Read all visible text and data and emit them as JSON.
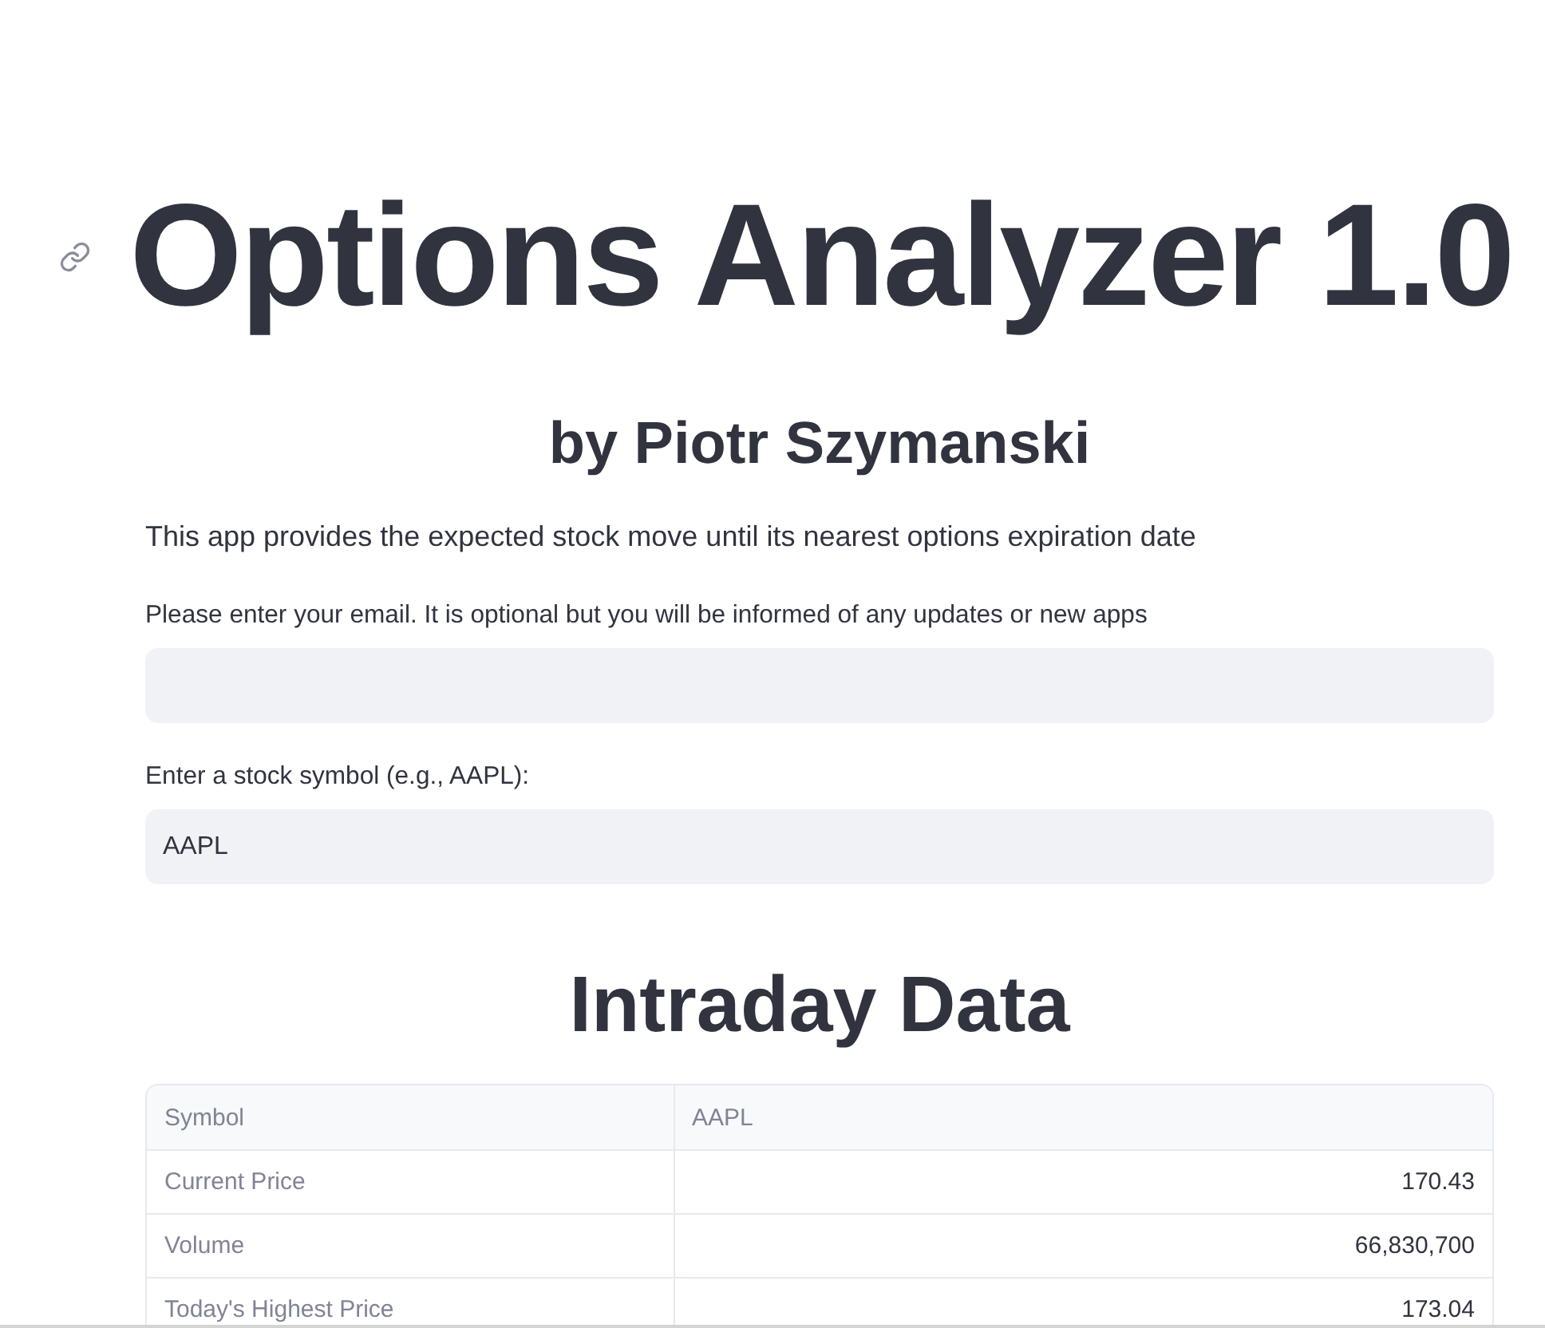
{
  "title": "Options Analyzer 1.0",
  "subtitle": "by Piotr Szymanski",
  "description": "This app provides the expected stock move until its nearest options expiration date",
  "fields": [
    {
      "label": "Please enter your email. It is optional but you will be informed of any updates or new apps"
    },
    {
      "label": "Enter a stock symbol (e.g., AAPL):",
      "value": "AAPL"
    }
  ],
  "section_title": "Intraday Data",
  "table": {
    "columns": [
      "Symbol",
      "AAPL"
    ],
    "rows": [
      [
        "Current Price",
        "170.43"
      ],
      [
        "Volume",
        "66,830,700"
      ],
      [
        "Today's Highest Price",
        "173.04"
      ]
    ]
  }
}
